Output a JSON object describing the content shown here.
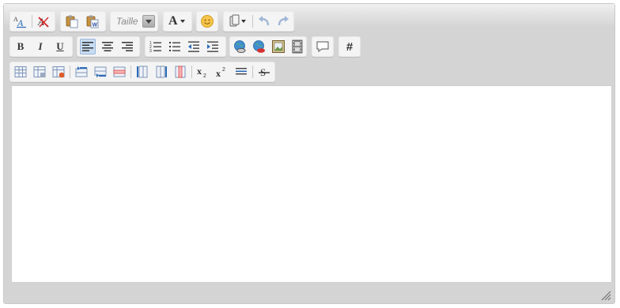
{
  "toolbar": {
    "font_size_label": "Taille",
    "font_color_letter": "A",
    "bold_letter": "B",
    "italic_letter": "I",
    "underline_letter": "U",
    "anchor_symbol": "#"
  },
  "content": {
    "text": ""
  }
}
